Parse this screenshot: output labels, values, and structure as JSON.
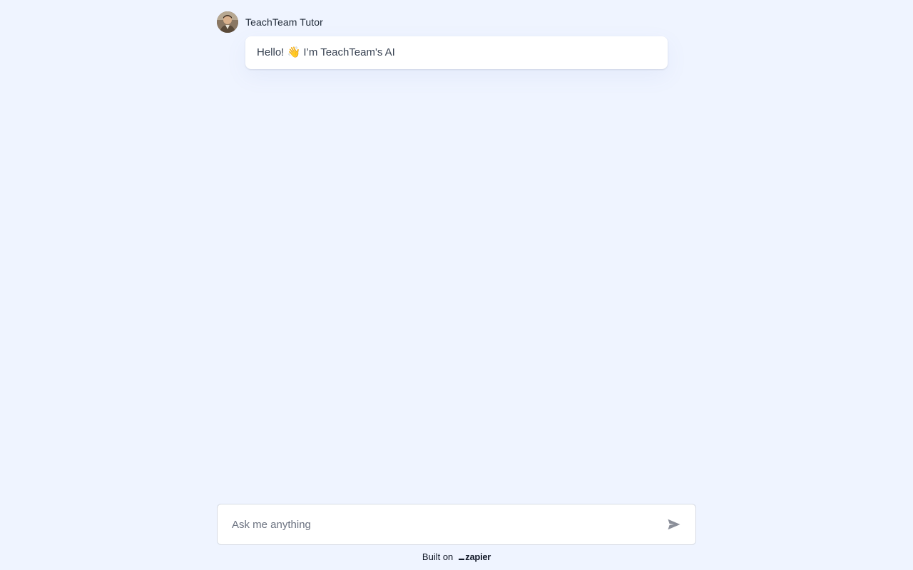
{
  "bot": {
    "name": "TeachTeam Tutor",
    "avatar_icon": "tutor-avatar"
  },
  "messages": [
    {
      "role": "assistant",
      "text": "Hello! 👋 I’m TeachTeam's AI"
    }
  ],
  "composer": {
    "placeholder": "Ask me anything",
    "value": "",
    "send_icon": "send-icon"
  },
  "footer": {
    "built_on_label": "Built on",
    "brand_name": "zapier"
  },
  "colors": {
    "background": "#eff4ff",
    "bubble": "#ffffff",
    "send_icon": "#8b8f99"
  }
}
